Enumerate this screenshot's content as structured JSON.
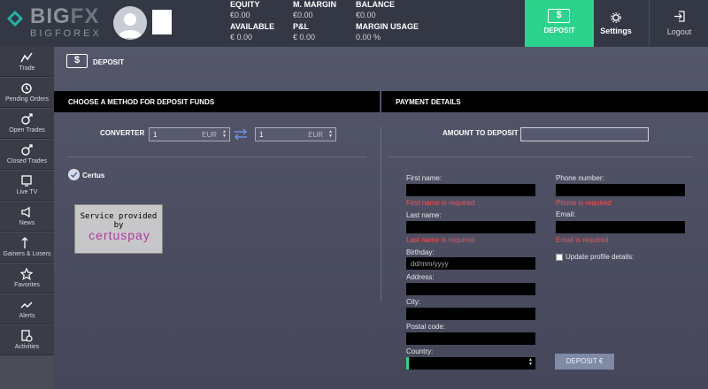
{
  "brand": {
    "name_main": "BIG",
    "name_accent": "FX",
    "sub": "BIGFOREX"
  },
  "stats": [
    {
      "label": "EQUITY",
      "value": "€0.00"
    },
    {
      "label": "AVAILABLE",
      "value": "€ 0.00"
    },
    {
      "label": "M. MARGIN",
      "value": "€0.00"
    },
    {
      "label": "P&L",
      "value": "€ 0.00"
    },
    {
      "label": "BALANCE",
      "value": "€0.00"
    },
    {
      "label": "MARGIN USAGE",
      "value": "0.00 %"
    }
  ],
  "topnav": {
    "deposit": "DEPOSIT",
    "settings": "Settings",
    "logout": "Logout"
  },
  "sidebar": [
    {
      "label": "Trade",
      "icon": "trade-icon"
    },
    {
      "label": "Pending Orders",
      "icon": "pending-orders-icon"
    },
    {
      "label": "Open Trades",
      "icon": "open-trades-icon"
    },
    {
      "label": "Closed Trades",
      "icon": "closed-trades-icon"
    },
    {
      "label": "Live TV",
      "icon": "live-tv-icon"
    },
    {
      "label": "News",
      "icon": "news-icon"
    },
    {
      "label": "Gainers & Losers",
      "icon": "gainers-losers-icon"
    },
    {
      "label": "Favorites",
      "icon": "favorites-icon"
    },
    {
      "label": "Alerts",
      "icon": "alerts-icon"
    },
    {
      "label": "Activities",
      "icon": "activities-icon"
    }
  ],
  "page": {
    "title": "DEPOSIT",
    "method_header": "CHOOSE A METHOD FOR DEPOSIT FUNDS",
    "payment_header": "PAYMENT DETAILS"
  },
  "converter": {
    "label": "CONVERTER",
    "from_value": "1",
    "from_currency": "EUR",
    "to_value": "1",
    "to_currency": "EUR"
  },
  "method": {
    "name": "Certus",
    "provider_text": "Service provided by",
    "provider_logo": "certuspay"
  },
  "amount": {
    "label": "AMOUNT TO DEPOSIT",
    "value": ""
  },
  "form": {
    "first_name": "First name:",
    "first_name_err": "First name is required",
    "last_name": "Last name:",
    "last_name_err": "Last name is required",
    "birthday": "Birthday:",
    "birthday_placeholder": "dd/mm/yyyy",
    "address": "Address:",
    "city": "City:",
    "postal": "Postal code:",
    "country": "Country:",
    "phone": "Phone number:",
    "phone_err": "Phone is required",
    "email": "Email:",
    "email_err": "Email is required",
    "update_profile": "Update profile details:",
    "deposit_btn": "DEPOSIT €"
  },
  "colors": {
    "accent": "#2cd38c",
    "error": "#ff4d4d",
    "topbar": "#343845"
  }
}
